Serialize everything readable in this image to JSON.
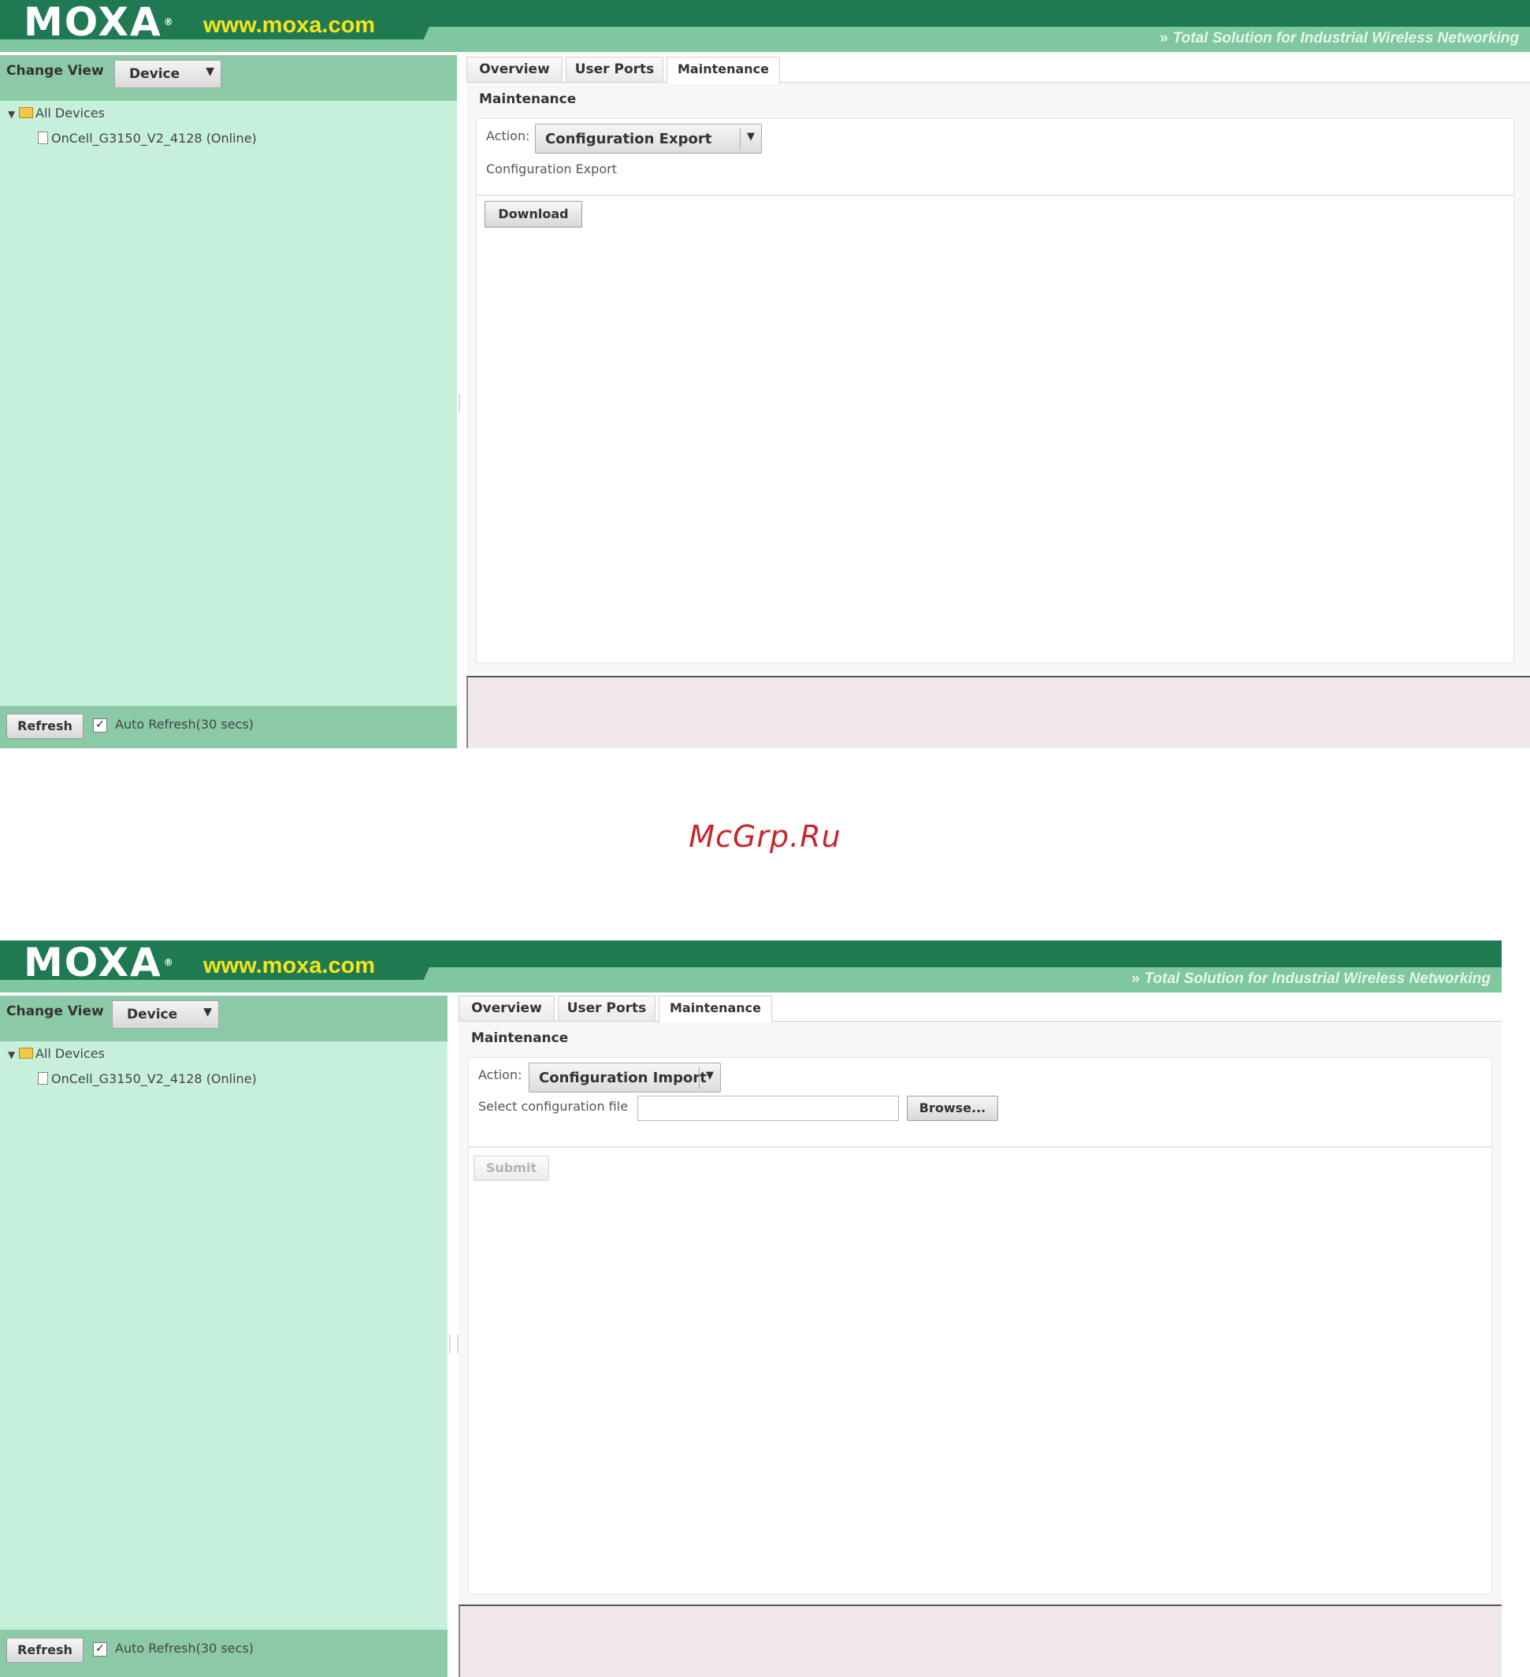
{
  "brand": {
    "logo": "MOXA",
    "url": "www.moxa.com",
    "tagline": "Total Solution for Industrial Wireless Networking"
  },
  "left_pane": {
    "change_view_label": "Change View",
    "view_select_value": "Device",
    "tree_root": "All Devices",
    "tree_device": "OnCell_G3150_V2_4128 (Online)",
    "refresh_button": "Refresh",
    "auto_refresh_label": "Auto Refresh(30 secs)",
    "auto_refresh_checked": true
  },
  "tabs": [
    "Overview",
    "User Ports",
    "Maintenance"
  ],
  "active_tab": "Maintenance",
  "section_title": "Maintenance",
  "action_label": "Action:",
  "screen1": {
    "action_value": "Configuration Export",
    "description": "Configuration Export",
    "button": "Download"
  },
  "screen2": {
    "action_value": "Configuration Import",
    "file_label": "Select configuration file",
    "file_value": "",
    "browse_button": "Browse...",
    "submit_button": "Submit"
  },
  "watermark": "McGrp.Ru",
  "colors": {
    "header_green": "#1f7a52",
    "header_band": "#7fc79e",
    "left_pane_bg": "#c7f0dc",
    "url_yellow": "#f4e41c",
    "watermark_red": "#c8262e",
    "message_area": "#f0e8e8"
  }
}
